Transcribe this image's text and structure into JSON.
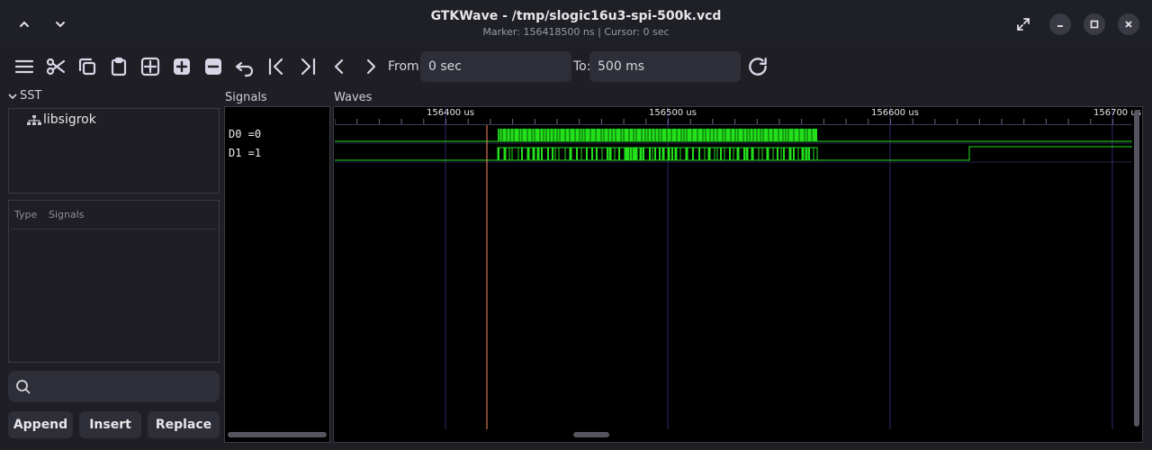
{
  "window": {
    "title": "GTKWave - /tmp/slogic16u3-spi-500k.vcd",
    "subtitle": "Marker: 156418500 ns  |  Cursor: 0 sec"
  },
  "toolbar": {
    "from_label": "From:",
    "from_value": "0 sec",
    "to_label": "To:",
    "to_value": "500 ms"
  },
  "sst": {
    "header": "SST",
    "tree_item": "libsigrok",
    "col_type": "Type",
    "col_signals": "Signals",
    "search_placeholder": ""
  },
  "buttons": {
    "append": "Append",
    "insert": "Insert",
    "replace": "Replace"
  },
  "signals": {
    "header": "Signals",
    "items": [
      {
        "label": "D0 =0"
      },
      {
        "label": "D1 =1"
      }
    ]
  },
  "waves": {
    "header": "Waves",
    "ticks": [
      "156400 us",
      "156500 us",
      "156600 us",
      "156700 us"
    ],
    "marker_color": "#ff8a65",
    "wave_color": "#22e01a"
  },
  "colors": {
    "accent": "#22e01a",
    "bg": "#1e1e24",
    "wave_bg": "#000000"
  }
}
